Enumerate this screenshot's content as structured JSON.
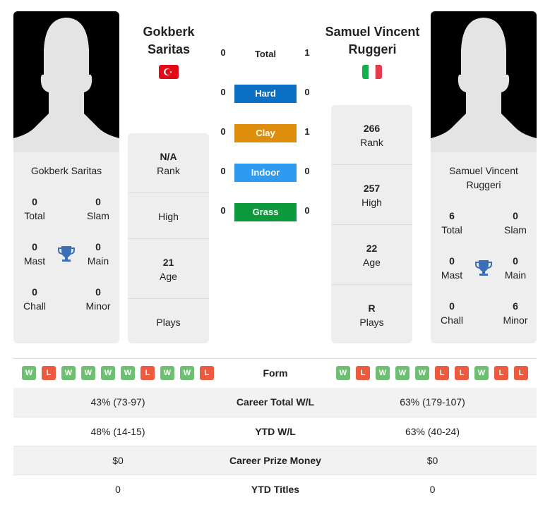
{
  "player1": {
    "name": "Gokberk Saritas",
    "name_line1": "Gokberk",
    "name_line2": "Saritas",
    "country": "Turkey",
    "flag_icon": "turkey-flag-icon",
    "titles": {
      "total": {
        "value": "0",
        "label": "Total"
      },
      "slam": {
        "value": "0",
        "label": "Slam"
      },
      "mast": {
        "value": "0",
        "label": "Mast"
      },
      "main": {
        "value": "0",
        "label": "Main"
      },
      "chall": {
        "value": "0",
        "label": "Chall"
      },
      "minor": {
        "value": "0",
        "label": "Minor"
      }
    },
    "stats": {
      "rank": {
        "value": "N/A",
        "label": "Rank"
      },
      "high": {
        "value": "",
        "label": "High"
      },
      "age": {
        "value": "21",
        "label": "Age"
      },
      "plays": {
        "value": "",
        "label": "Plays"
      }
    },
    "form": [
      "W",
      "L",
      "W",
      "W",
      "W",
      "W",
      "L",
      "W",
      "W",
      "L"
    ]
  },
  "player2": {
    "name": "Samuel Vincent Ruggeri",
    "name_line1": "Samuel Vincent",
    "name_line2": "Ruggeri",
    "card_line1": "Samuel Vincent",
    "card_line2": "Ruggeri",
    "country": "Italy",
    "flag_icon": "italy-flag-icon",
    "titles": {
      "total": {
        "value": "6",
        "label": "Total"
      },
      "slam": {
        "value": "0",
        "label": "Slam"
      },
      "mast": {
        "value": "0",
        "label": "Mast"
      },
      "main": {
        "value": "0",
        "label": "Main"
      },
      "chall": {
        "value": "0",
        "label": "Chall"
      },
      "minor": {
        "value": "6",
        "label": "Minor"
      }
    },
    "stats": {
      "rank": {
        "value": "266",
        "label": "Rank"
      },
      "high": {
        "value": "257",
        "label": "High"
      },
      "age": {
        "value": "22",
        "label": "Age"
      },
      "plays": {
        "value": "R",
        "label": "Plays"
      }
    },
    "form": [
      "W",
      "L",
      "W",
      "W",
      "W",
      "L",
      "L",
      "W",
      "L",
      "L"
    ]
  },
  "h2h": {
    "total": {
      "label": "Total",
      "p1": "0",
      "p2": "1"
    },
    "surfaces": [
      {
        "label": "Hard",
        "p1": "0",
        "p2": "0",
        "color": "#0b6fc4"
      },
      {
        "label": "Clay",
        "p1": "0",
        "p2": "1",
        "color": "#dd8e0c"
      },
      {
        "label": "Indoor",
        "p1": "0",
        "p2": "0",
        "color": "#2f9bf0"
      },
      {
        "label": "Grass",
        "p1": "0",
        "p2": "0",
        "color": "#0d9a3c"
      }
    ]
  },
  "comparison": {
    "form_label": "Form",
    "rows": [
      {
        "label": "Career Total W/L",
        "p1": "43% (73-97)",
        "p2": "63% (179-107)"
      },
      {
        "label": "YTD W/L",
        "p1": "48% (14-15)",
        "p2": "63% (40-24)"
      },
      {
        "label": "Career Prize Money",
        "p1": "$0",
        "p2": "$0"
      },
      {
        "label": "YTD Titles",
        "p1": "0",
        "p2": "0"
      }
    ]
  },
  "colors": {
    "win": "#6fbf73",
    "loss": "#ec5b40",
    "trophy": "#3a6fb8"
  }
}
